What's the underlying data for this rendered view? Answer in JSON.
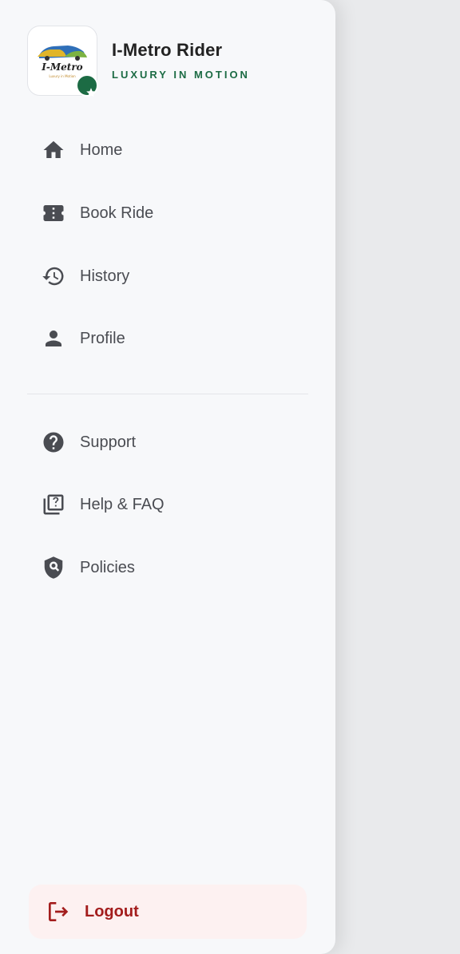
{
  "app": {
    "title": "I-Metro Rider",
    "tagline": "LUXURY IN MOTION",
    "logo_text": "I-Metro",
    "logo_subtext": "Luxury in Motion"
  },
  "nav": {
    "primary": [
      {
        "label": "Home",
        "icon": "home-icon"
      },
      {
        "label": "Book Ride",
        "icon": "ticket-icon"
      },
      {
        "label": "History",
        "icon": "history-icon"
      },
      {
        "label": "Profile",
        "icon": "person-icon"
      }
    ],
    "secondary": [
      {
        "label": "Support",
        "icon": "help-circle-icon"
      },
      {
        "label": "Help & FAQ",
        "icon": "quiz-icon"
      },
      {
        "label": "Policies",
        "icon": "shield-search-icon"
      }
    ]
  },
  "logout": {
    "label": "Logout",
    "icon": "logout-icon"
  },
  "colors": {
    "accent_green": "#1c6b44",
    "logout_red": "#a31d1d",
    "icon_gray": "#4a4c52",
    "drawer_bg": "#f7f8fa"
  }
}
